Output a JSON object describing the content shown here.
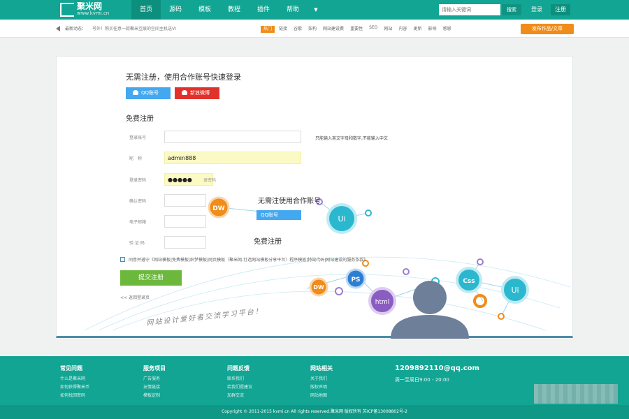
{
  "header": {
    "logo_name": "聚米网",
    "logo_url": "www.kvmi.cn",
    "nav": [
      {
        "label": "首页"
      },
      {
        "label": "源码"
      },
      {
        "label": "模板"
      },
      {
        "label": "教程"
      },
      {
        "label": "插件"
      },
      {
        "label": "帮助"
      }
    ],
    "nav_more": "▼",
    "search_placeholder": "请输入关键词",
    "search_button": "搜索",
    "login": "登录",
    "register": "注册"
  },
  "newsbar": {
    "label": "最新动态：",
    "text": "号外！购买任意一款聚米互联的空间主机送VI",
    "hot": "热门",
    "tags": [
      "链接",
      "谷歌",
      "架构",
      "网站建设费",
      "重要性",
      "SEO",
      "网站",
      "内容",
      "更新",
      "影响",
      "感恩"
    ],
    "publish": "发布作品/文章"
  },
  "form": {
    "quick_title": "无需注册，使用合作账号快速登录",
    "qq": "QQ账号",
    "weibo": "新浪微博",
    "free_title": "免费注册",
    "fields": [
      {
        "label": "登录账号",
        "value": ""
      },
      {
        "label": "昵　称",
        "value": "admin888"
      },
      {
        "label": "登录密码",
        "value": "●●●●●"
      },
      {
        "label": "确认密码",
        "value": ""
      },
      {
        "label": "电子邮箱",
        "value": ""
      },
      {
        "label": "验 证 码",
        "value": ""
      }
    ],
    "account_hint": "只能输入英文字母和数字,不能输入中文",
    "ghost_password": "录密码",
    "agree": "同意并遵守《网站模板|免费模板|织梦模板|网页模板（聚米网-打造网站模板分享平台）程序模板|特效代码|网站建设的服务条款》",
    "submit": "提交注册",
    "back": "<< 返回登录页"
  },
  "illustration": {
    "slogan": "网站设计爱好者交流学习平台！",
    "echo_title": "无需注使用合作账号",
    "echo_qq": "QQ账号",
    "echo_free": "免费注册",
    "bubbles": [
      "DW",
      "Ui",
      "DW",
      "PS",
      "html",
      "Css",
      "Ui"
    ]
  },
  "footer": {
    "cols": [
      {
        "head": "常见问题",
        "links": [
          "什么是聚米网",
          "如何获得聚米币",
          "如何找回密码"
        ]
      },
      {
        "head": "服务项目",
        "links": [
          "广告服务",
          "友情链接",
          "模板定制"
        ]
      },
      {
        "head": "问题反馈",
        "links": [
          "联系我们",
          "给我们提建议",
          "加群交流"
        ]
      },
      {
        "head": "网站相关",
        "links": [
          "关于我们",
          "版权声明",
          "网站地图"
        ]
      }
    ],
    "email": "1209892110@qq.com",
    "hours": "周一至周日9:00 - 20:00",
    "copyright": "Copyright © 2011-2015 kvmi.cn All rights reserved.聚米网 版权所有 苏ICP备13008802号-2"
  },
  "colors": {
    "brand": "#12a593",
    "accent": "#f08c19",
    "submit": "#6bb83c",
    "qq": "#43a8f0",
    "weibo": "#e0322b"
  }
}
